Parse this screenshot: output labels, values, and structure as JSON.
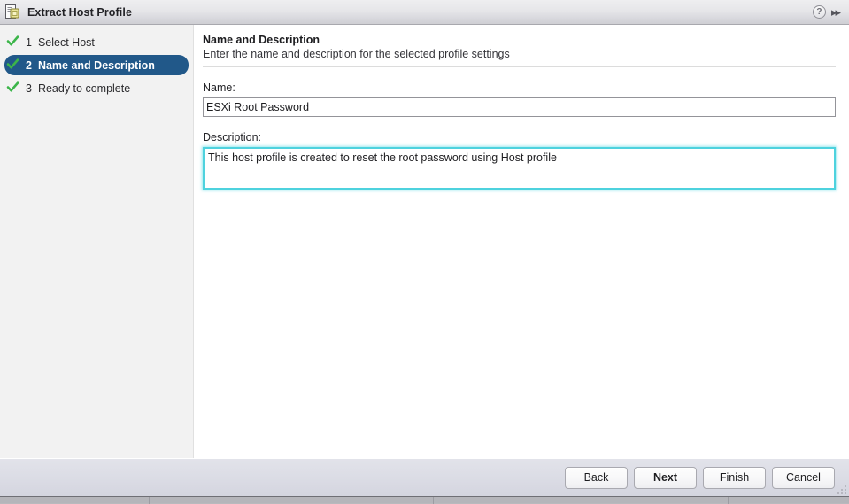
{
  "window": {
    "title": "Extract Host Profile",
    "icon": "host-profile-icon",
    "help_icon": "?",
    "collapse_icon": "▸▸"
  },
  "sidebar": {
    "steps": [
      {
        "number": "1",
        "label": "Select Host",
        "state": "complete",
        "active": false
      },
      {
        "number": "2",
        "label": "Name and Description",
        "state": "complete",
        "active": true
      },
      {
        "number": "3",
        "label": "Ready to complete",
        "state": "complete",
        "active": false
      }
    ]
  },
  "content": {
    "title": "Name and Description",
    "subtitle": "Enter the name and description for the selected profile settings",
    "name_label": "Name:",
    "name_value": "ESXi Root Password",
    "name_placeholder": "Enter profile name",
    "description_label": "Description:",
    "description_value": "This host profile is created to reset the root password using Host profile",
    "description_placeholder": "Enter description"
  },
  "footer": {
    "back": "Back",
    "next": "Next",
    "finish": "Finish",
    "cancel": "Cancel"
  },
  "colors": {
    "active_step_bg": "#215889",
    "check_green": "#3cb54a",
    "focus_cyan": "#4ed2de",
    "footer_bg": "#dadbe4",
    "titlebar_bg": "#e6e6e9"
  }
}
